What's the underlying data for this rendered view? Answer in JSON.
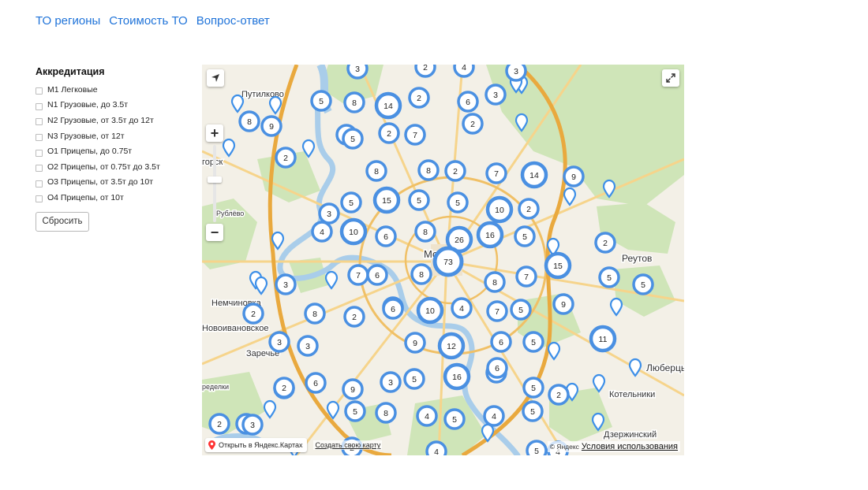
{
  "nav": {
    "links": [
      {
        "label": "ТО регионы"
      },
      {
        "label": "Стоимость ТО"
      },
      {
        "label": "Вопрос-ответ"
      }
    ]
  },
  "filters": {
    "title": "Аккредитация",
    "items": [
      {
        "label": "M1 Легковые",
        "checked": false
      },
      {
        "label": "N1 Грузовые, до 3.5т",
        "checked": false
      },
      {
        "label": "N2 Грузовые, от 3.5т до 12т",
        "checked": false
      },
      {
        "label": "N3 Грузовые, от 12т",
        "checked": false
      },
      {
        "label": "O1 Прицепы, до 0.75т",
        "checked": false
      },
      {
        "label": "O2 Прицепы, от 0.75т до 3.5т",
        "checked": false
      },
      {
        "label": "O3 Прицепы, от 3.5т до 10т",
        "checked": false
      },
      {
        "label": "O4 Прицепы, от 10т",
        "checked": false
      }
    ],
    "reset_label": "Сбросить"
  },
  "map": {
    "place_labels": [
      "Путилково",
      "горск",
      "Рублёво",
      "Москва",
      "Реутов",
      "Немчиновка",
      "Новоивановское",
      "Заречье",
      "Люберцы",
      "Котельники",
      "Дзержинский",
      "ределки"
    ],
    "open_in_yandex_label": "Открыть в Яндекс.Картах",
    "create_map_label": "Создать свою карту",
    "copyright": "© Яндекс",
    "terms_label": "Условия использования",
    "colors": {
      "cluster": "#4a90e2",
      "pin": "#3d8fe8",
      "park": "#cfe5b8",
      "water": "#a9cdea",
      "road": "#f5c76a",
      "ring": "#e9a93e"
    },
    "clusters": [
      3,
      2,
      4,
      3,
      5,
      8,
      14,
      2,
      6,
      3,
      8,
      9,
      4,
      2,
      7,
      2,
      5,
      2,
      8,
      8,
      2,
      7,
      14,
      9,
      5,
      15,
      5,
      5,
      10,
      2,
      3,
      4,
      10,
      6,
      8,
      26,
      16,
      5,
      2,
      73,
      15,
      7,
      6,
      8,
      8,
      7,
      5,
      5,
      3,
      2,
      8,
      10,
      4,
      7,
      5,
      9,
      3,
      2,
      8,
      6,
      3,
      9,
      12,
      6,
      5,
      11,
      6,
      16,
      6,
      2,
      6,
      9,
      3,
      5,
      5,
      2,
      2,
      5,
      8,
      4,
      5,
      4,
      5,
      2,
      3,
      4,
      5,
      4,
      2,
      2
    ]
  }
}
